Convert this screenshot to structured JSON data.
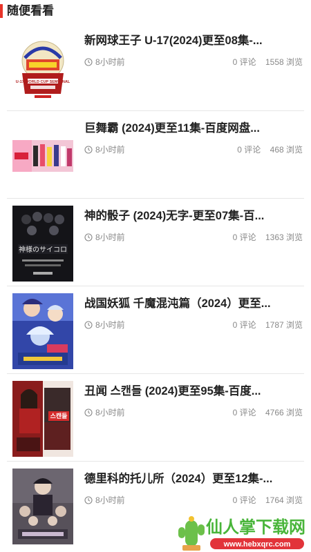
{
  "section": {
    "title": "随便看看"
  },
  "items": [
    {
      "title": "新网球王子 U-17(2024)更至08集-...",
      "time": "8小时前",
      "comments": "0 评论",
      "views": "1558 浏览",
      "poster_text": "U-17 WORLD CUP SEMIFINAL"
    },
    {
      "title": "巨舞霸 (2024)更至11集-百度网盘...",
      "time": "8小时前",
      "comments": "0 评论",
      "views": "468 浏览",
      "poster_text": ""
    },
    {
      "title": "神的骰子 (2024)无字-更至07集-百...",
      "time": "8小时前",
      "comments": "0 评论",
      "views": "1363 浏览",
      "poster_text": "神様のサイコロ"
    },
    {
      "title": "战国妖狐 千魔混沌篇（2024）更至...",
      "time": "8小时前",
      "comments": "0 评论",
      "views": "1787 浏览",
      "poster_text": ""
    },
    {
      "title": "丑闻 스캔들 (2024)更至95集-百度...",
      "time": "8小时前",
      "comments": "0 评论",
      "views": "4766 浏览",
      "poster_text": "스캔들"
    },
    {
      "title": "德里科的托儿所（2024）更至12集-...",
      "time": "8小时前",
      "comments": "0 评论",
      "views": "1764 浏览",
      "poster_text": ""
    }
  ],
  "watermark": {
    "name": "仙人掌下载网",
    "url": "www.hebxqrc.com"
  },
  "colors": {
    "accent": "#e8342a",
    "meta": "#888888",
    "divider": "#e6e6e6"
  }
}
